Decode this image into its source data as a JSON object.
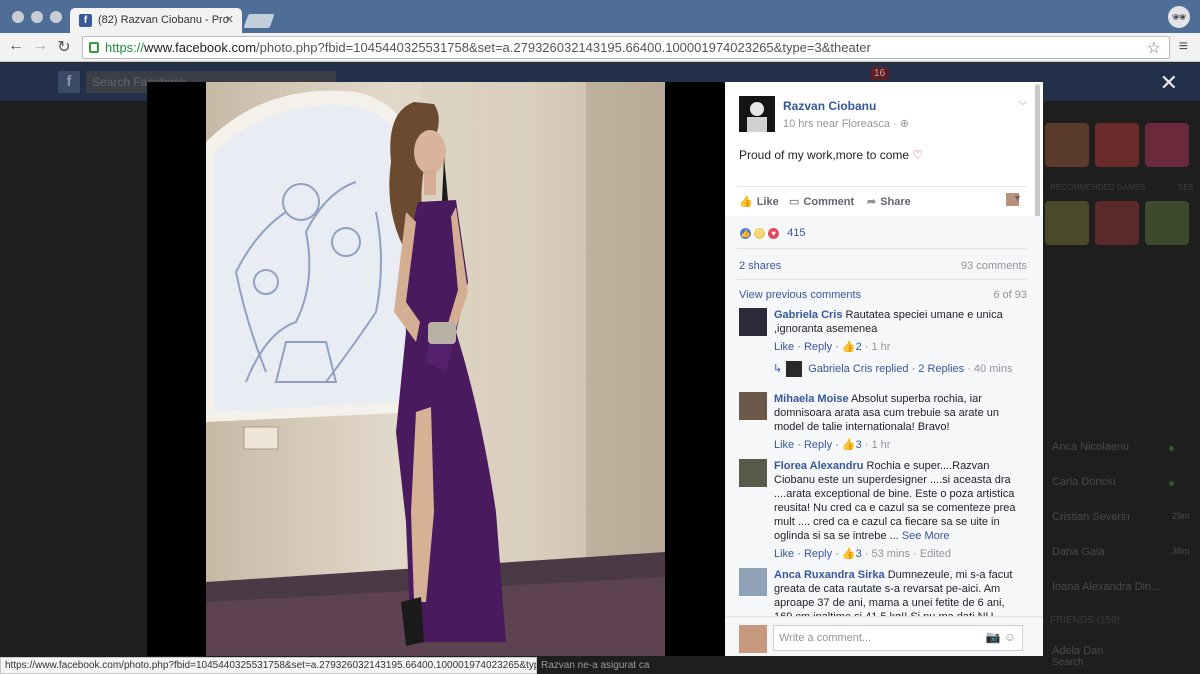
{
  "browser": {
    "tab_title": "(82) Razvan Ciobanu - Pro",
    "tab_favicon": "f",
    "url_scheme": "https://",
    "url_host": "www.facebook.com",
    "url_path": "/photo.php?fbid=1045440325531758&set=a.279326032143195.66400.100001974023265&type=3&theater",
    "status_url": "https://www.facebook.com/photo.php?fbid=1045440325531758&set=a.279326032143195.66400.100001974023265&type=3&theater"
  },
  "fb_header": {
    "search_placeholder": "Search Facebook",
    "notif_count": "16"
  },
  "sidebar": {
    "recommended_label": "RECOMMENDED GAMES",
    "see_label": "SEE",
    "friends_label": "FRIENDS (159)",
    "contacts": [
      {
        "name": "Anca Nicolaenu"
      },
      {
        "name": "Carla Donciu"
      },
      {
        "name": "Cristian Severin",
        "time": "29m"
      },
      {
        "name": "Dana Gaia",
        "time": "38m"
      },
      {
        "name": "Ioana Alexandra Din..."
      },
      {
        "name": "Adela Dan"
      }
    ],
    "search_placeholder": "Search"
  },
  "post": {
    "author": "Razvan Ciobanu",
    "meta": "10 hrs near Floreasca",
    "caption": "Proud of my work,more to come",
    "like_label": "Like",
    "comment_label": "Comment",
    "share_label": "Share",
    "reaction_count": "415",
    "shares": "2 shares",
    "comments_count": "93 comments",
    "view_previous": "View previous comments",
    "pager": "6 of 93",
    "write_placeholder": "Write a comment..."
  },
  "comments": [
    {
      "author": "Gabriela Cris",
      "text": "Rautatea speciei umane e unica ,ignoranta asemenea",
      "like": "Like",
      "reply": "Reply",
      "likes": "2",
      "time": "1 hr",
      "reply_summary": {
        "author": "Gabriela Cris replied",
        "count": "2 Replies",
        "time": "40 mins"
      }
    },
    {
      "author": "Mihaela Moise",
      "text": "Absolut superba rochia, iar domnisoara arata asa cum trebuie sa arate un model de talie internationala! Bravo!",
      "like": "Like",
      "reply": "Reply",
      "likes": "3",
      "time": "1 hr"
    },
    {
      "author": "Florea Alexandru",
      "text": "Rochia e super....Razvan Ciobanu este un superdesigner ....si aceasta dra ....arata exceptional de bine. Este o poza artistica reusita! Nu cred ca e cazul sa se comenteze prea mult .... cred ca e cazul ca fiecare sa se uite in oglinda si sa se intrebe ...",
      "see_more": "See More",
      "like": "Like",
      "reply": "Reply",
      "likes": "3",
      "time": "53 mins",
      "edited": "Edited"
    },
    {
      "author": "Anca Ruxandra Sirka",
      "text": "Dumnezeule, mi s-a facut greata de cata rautate s-a revarsat pe-aici. Am aproape 37 de ani, mama a unei fetite de 6 ani, 169 cm inaltime si 41,5 kg!! Si nu ma dati NU"
    }
  ],
  "status_tail": "Razvan ne-a asigurat ca",
  "colors": {
    "link": "#365899",
    "dress": "#4a1a5e",
    "chrome": "#4e6d97"
  }
}
